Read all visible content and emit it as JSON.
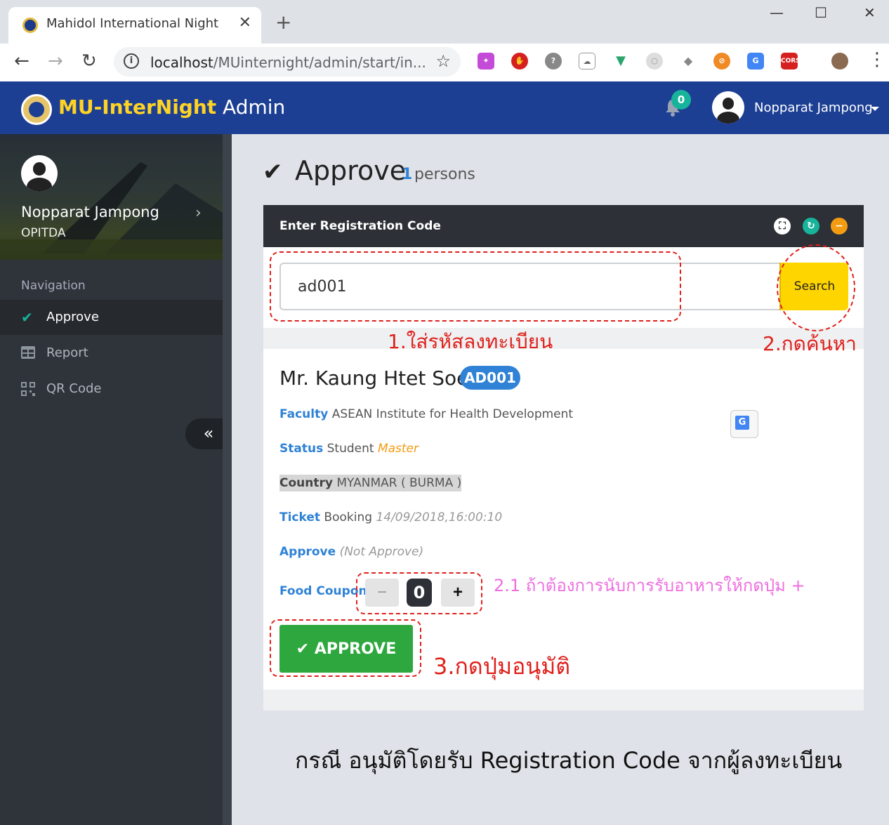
{
  "browser": {
    "tab_title": "Mahidol International Night",
    "tab_close": "✕",
    "new_tab": "+",
    "url_host": "localhost",
    "url_rest": "/MUinternight/admin/start/in...",
    "win_min": "—",
    "win_max": "☐",
    "win_close": "✕"
  },
  "header": {
    "brand": "MU-InterNight",
    "brand_suffix": " Admin",
    "notification_count": "0",
    "user_name": "Nopparat Jampong"
  },
  "sidebar": {
    "profile_name": "Nopparat Jampong",
    "profile_org": "OPITDA",
    "nav_title": "Navigation",
    "items": [
      {
        "label": "Approve",
        "icon": "check-icon",
        "active": true
      },
      {
        "label": "Report",
        "icon": "table-icon",
        "active": false
      },
      {
        "label": "QR Code",
        "icon": "qrcode-icon",
        "active": false
      }
    ],
    "collapse_label": "«"
  },
  "page": {
    "title": "Approve",
    "count": "1",
    "count_unit": "persons"
  },
  "panel": {
    "title": "Enter Registration Code",
    "search_value": "ad001",
    "search_button": "Search"
  },
  "person": {
    "name": "Mr. Kaung Htet Soe",
    "code": "AD001",
    "faculty_label": "Faculty",
    "faculty": "ASEAN Institute for Health Development",
    "status_label": "Status",
    "status": "Student",
    "status_level": "Master",
    "country_label": "Country",
    "country": "MYANMAR ( BURMA )",
    "ticket_label": "Ticket",
    "ticket": "Booking",
    "ticket_time": "14/09/2018,16:00:10",
    "approve_label": "Approve",
    "approve_state": "(Not Approve)",
    "coupon_label": "Food Coupon",
    "coupon_minus": "−",
    "coupon_value": "0",
    "coupon_plus": "+",
    "approve_button": "APPROVE"
  },
  "annotations": {
    "step1": "1.ใส่รหัสลงทะเบียน",
    "step2": "2.กดค้นหา",
    "step21": "2.1 ถ้าต้องการนับการรับอาหารให้กดปุ่ม +",
    "step3": "3.กดปุ่มอนุมัติ",
    "caption": "กรณี อนุมัติโดยรับ Registration Code จากผู้ลงทะเบียน"
  },
  "colors": {
    "header_bg": "#1c3f94",
    "brand_yellow": "#ffd324",
    "accent_blue": "#2f82d6",
    "teal": "#17b39a",
    "approve_green": "#2ea83e",
    "annotation_red": "#e0201b",
    "annotation_pink": "#ee6fe0"
  }
}
